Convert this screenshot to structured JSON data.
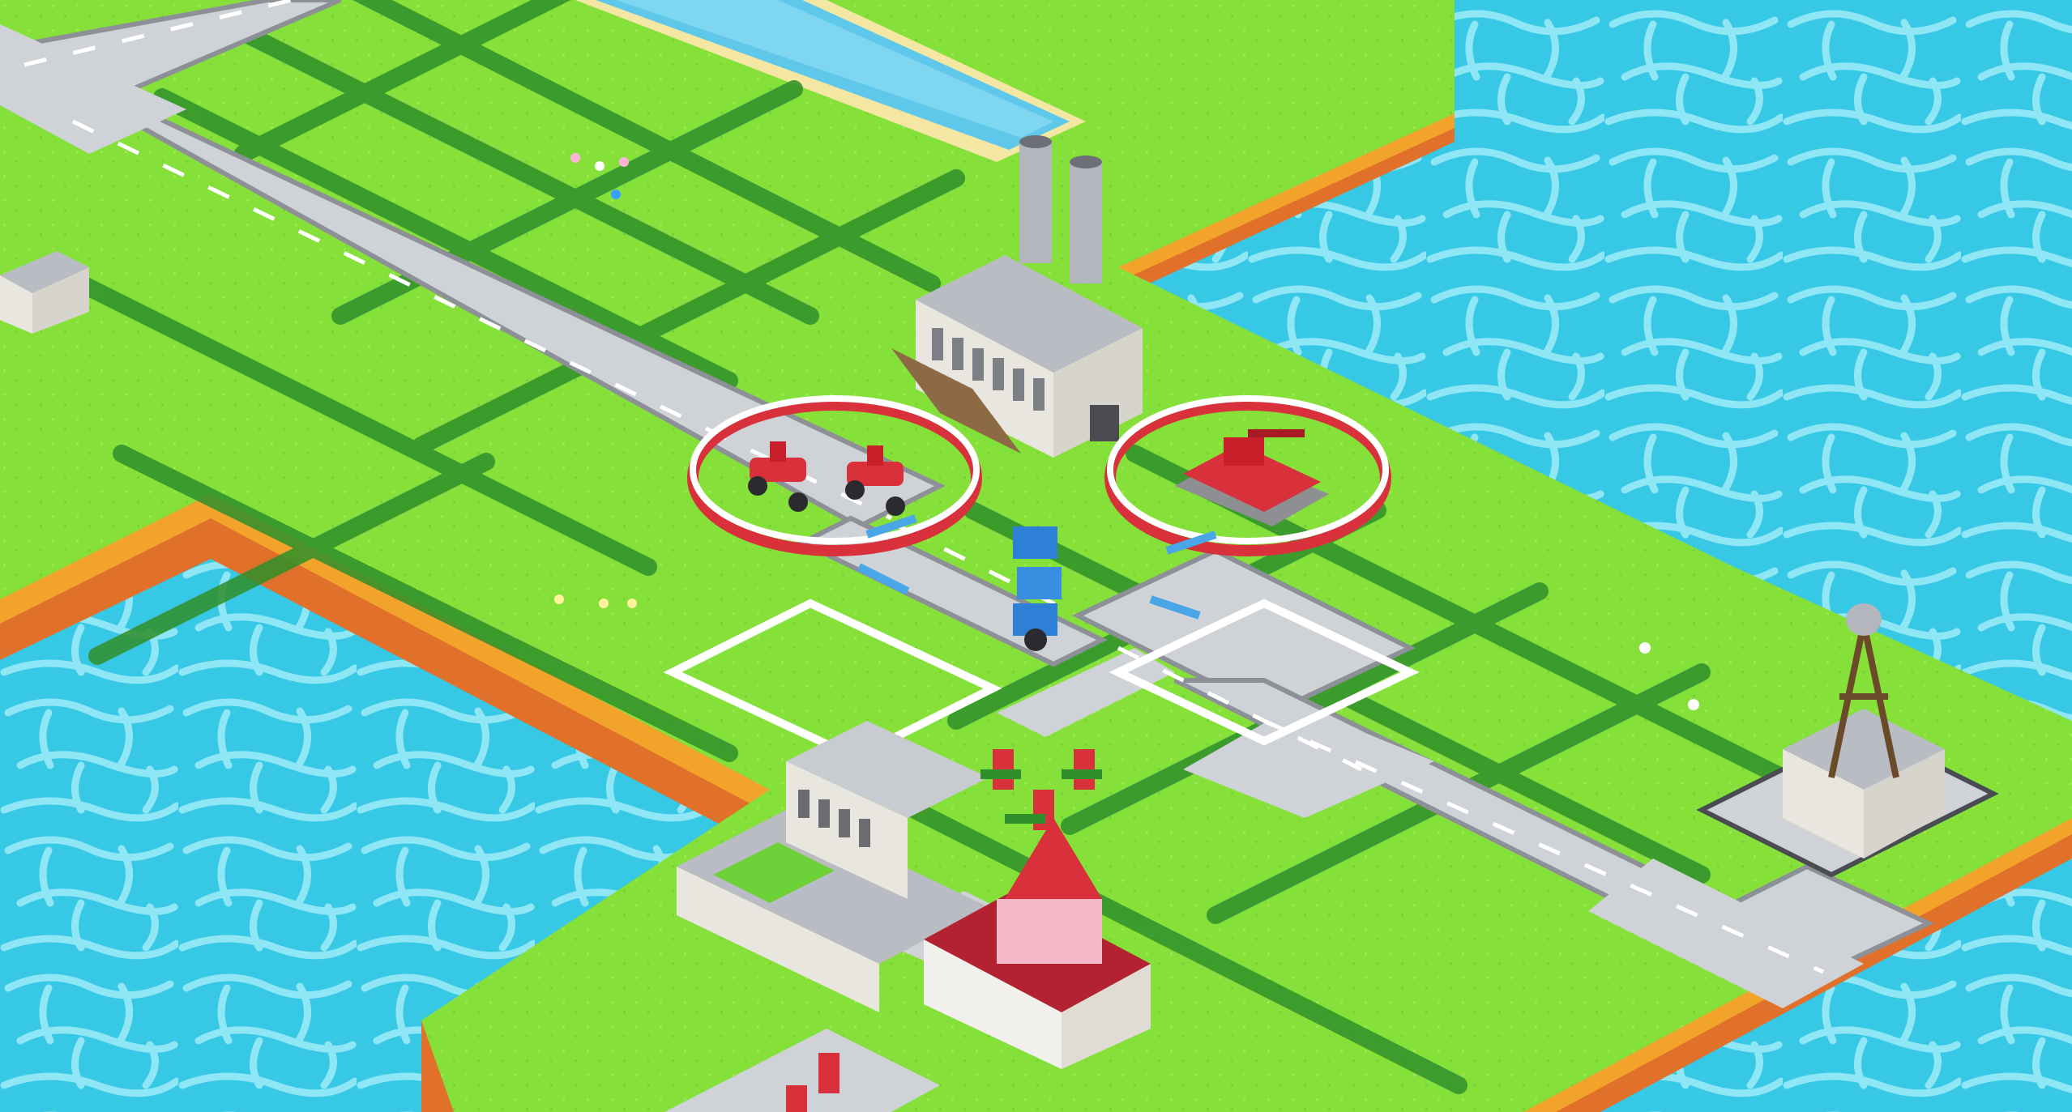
{
  "scene": {
    "type": "isometric voxel strategy map",
    "colors": {
      "water": "#37c8e6",
      "water_cell_line": "#8fe6f5",
      "grass": "#86e03a",
      "grass_dark": "#4fb52a",
      "hedge": "#2f8f2a",
      "road": "#cfd2d6",
      "road_marking": "#ffffff",
      "curb": "#8d9097",
      "cliff_top": "#f2a42a",
      "cliff_bottom": "#e0702a",
      "player_red": "#d8313b",
      "player_blue": "#2e7fd6",
      "building_wall": "#e9e6df",
      "building_roof": "#b9bcc2",
      "range_ring": "#ffffff"
    },
    "units": [
      {
        "name": "red-motorcycle",
        "count": 2
      },
      {
        "name": "red-tank",
        "count": 1
      },
      {
        "name": "blue-mech-stack",
        "count": 1
      },
      {
        "name": "red-infantry",
        "count": 5
      }
    ],
    "structures": [
      {
        "name": "factory",
        "owner": "neutral"
      },
      {
        "name": "barracks",
        "owner": "neutral"
      },
      {
        "name": "headquarters",
        "owner": "red"
      },
      {
        "name": "water-tower-outpost",
        "owner": "neutral"
      },
      {
        "name": "city-block",
        "owner": "neutral"
      }
    ]
  }
}
